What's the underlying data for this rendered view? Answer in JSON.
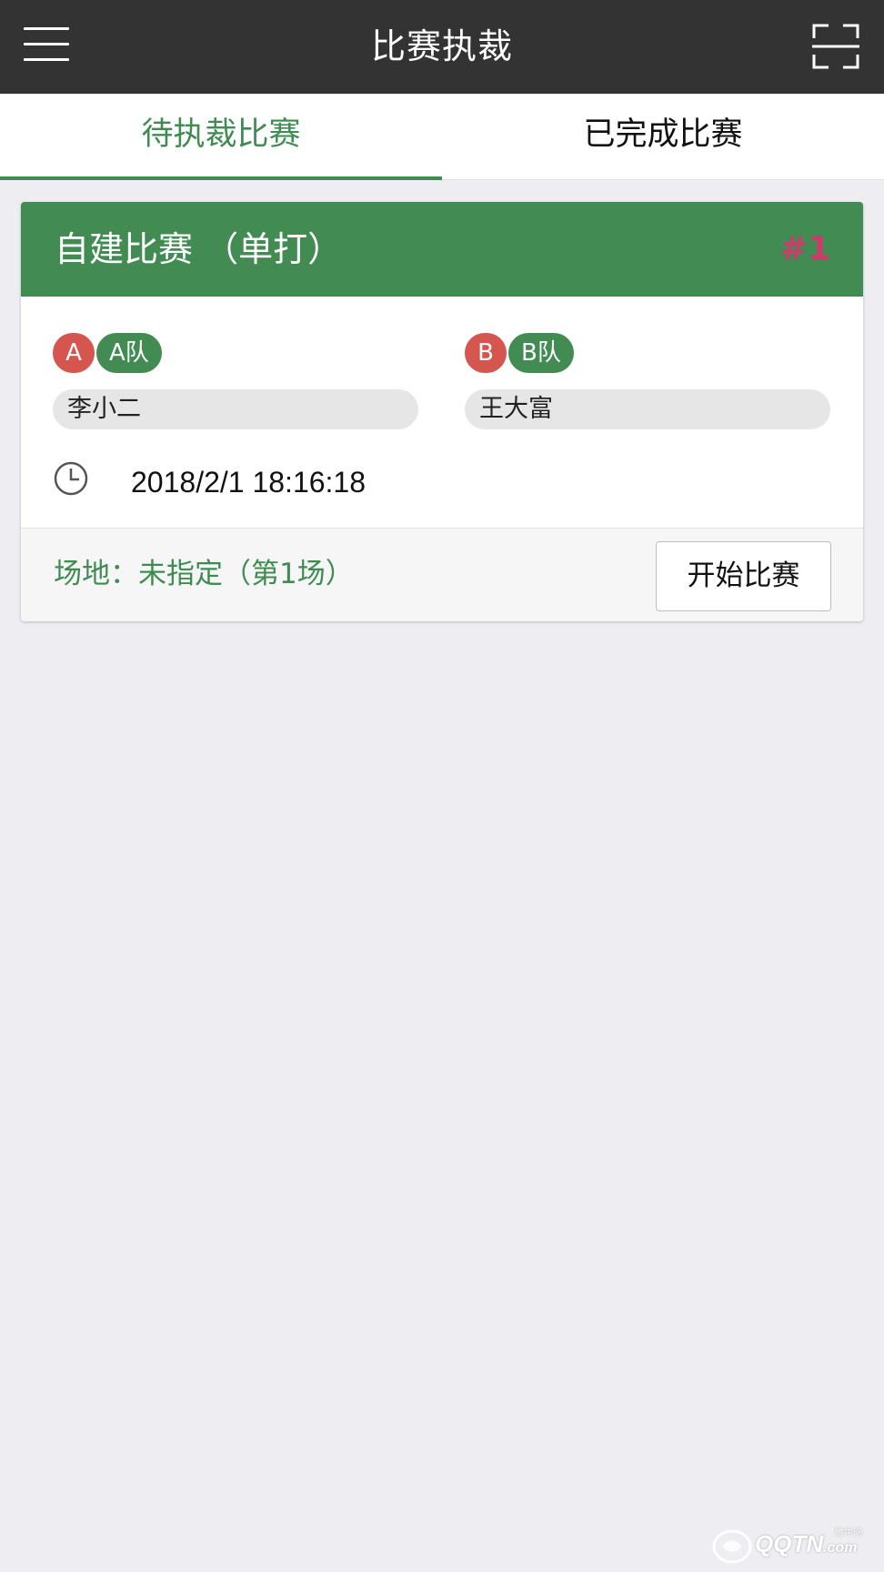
{
  "header": {
    "title": "比赛执裁",
    "menu_icon": "hamburger-menu-icon",
    "scan_icon": "scan-frame-icon"
  },
  "tabs": [
    {
      "label": "待执裁比赛",
      "active": true
    },
    {
      "label": "已完成比赛",
      "active": false
    }
  ],
  "match": {
    "title": "自建比赛 （单打）",
    "number": "#1",
    "team_a": {
      "badge": "A",
      "name": "A队",
      "player": "李小二"
    },
    "team_b": {
      "badge": "B",
      "name": "B队",
      "player": "王大富"
    },
    "clock_icon": "clock-icon",
    "time": "2018/2/1 18:16:18",
    "venue": "场地：未指定（第1场）",
    "start_button": "开始比赛"
  },
  "watermark": {
    "text": "QQTN",
    "suffix": ".com",
    "small": "腾牛网"
  },
  "colors": {
    "topbar": "#333333",
    "accent_green": "#428c54",
    "badge_red": "#d4564f",
    "match_number": "#cc3c6b",
    "background": "#ededf2"
  }
}
